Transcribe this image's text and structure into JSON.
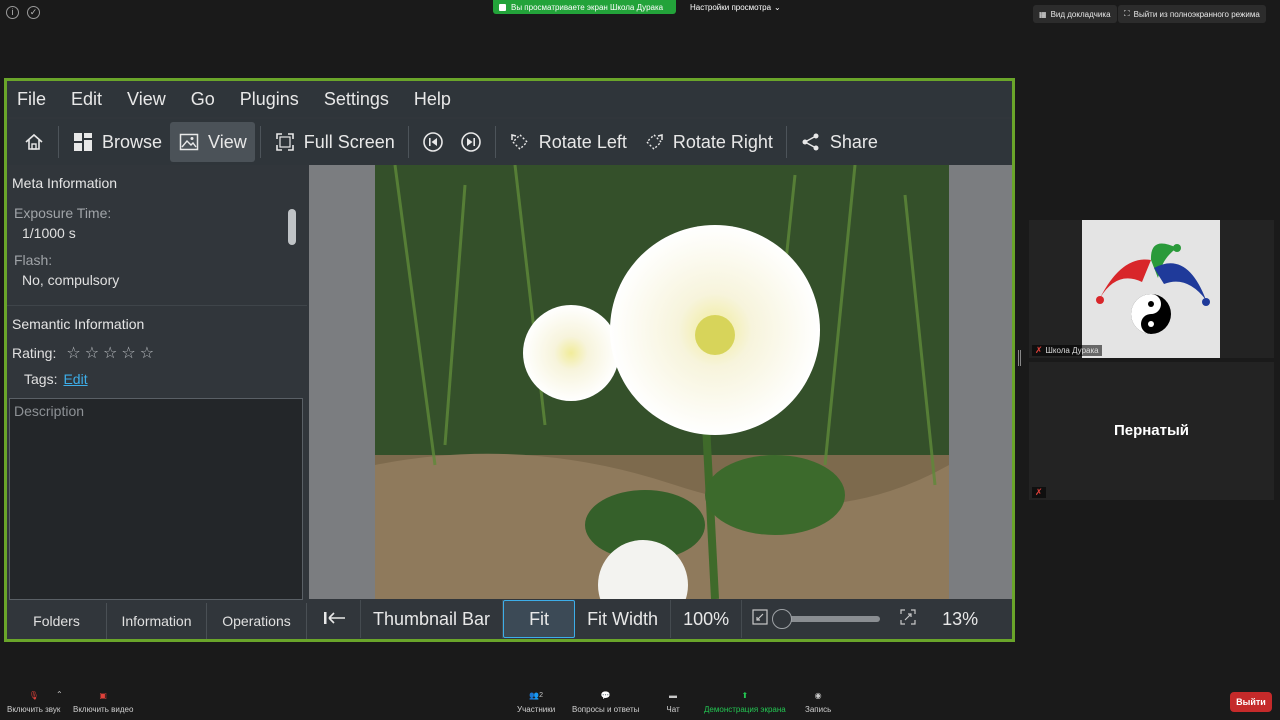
{
  "zoom": {
    "viewing_banner": "Вы просматриваете экран Школа Дурака",
    "view_options": "Настройки просмотра",
    "speaker_view": "Вид докладчика",
    "exit_fullscreen": "Выйти из полноэкранного режима",
    "participants": [
      {
        "name": "Школа Дурака"
      },
      {
        "name": "Пернатый"
      }
    ],
    "controls": {
      "mute": "Включить звук",
      "video": "Включить видео",
      "participants": "Участники",
      "participants_count": "2",
      "qa": "Вопросы и ответы",
      "chat": "Чат",
      "share": "Демонстрация экрана",
      "record": "Запись",
      "leave": "Выйти"
    }
  },
  "app": {
    "menu": [
      "File",
      "Edit",
      "View",
      "Go",
      "Plugins",
      "Settings",
      "Help"
    ],
    "toolbar": {
      "browse": "Browse",
      "view": "View",
      "fullscreen": "Full Screen",
      "rotate_left": "Rotate Left",
      "rotate_right": "Rotate Right",
      "share": "Share"
    },
    "sidebar": {
      "meta_heading": "Meta Information",
      "exposure_label": "Exposure Time:",
      "exposure_value": "1/1000 s",
      "flash_label": "Flash:",
      "flash_value": "No, compulsory",
      "semantic_heading": "Semantic Information",
      "rating_label": "Rating:",
      "rating_value": 0,
      "rating_max": 5,
      "tags_label": "Tags:",
      "tags_edit": "Edit",
      "description_placeholder": "Description",
      "tabs": [
        "Folders",
        "Information",
        "Operations"
      ]
    },
    "bottom": {
      "thumbnail_bar": "Thumbnail Bar",
      "fit": "Fit",
      "fit_width": "Fit Width",
      "zoom_100": "100%",
      "zoom_value": "13%"
    }
  },
  "colors": {
    "accent": "#3daee9",
    "window_border": "#6aa52a",
    "zoom_green": "#23a33a",
    "leave_red": "#c52a2a"
  }
}
